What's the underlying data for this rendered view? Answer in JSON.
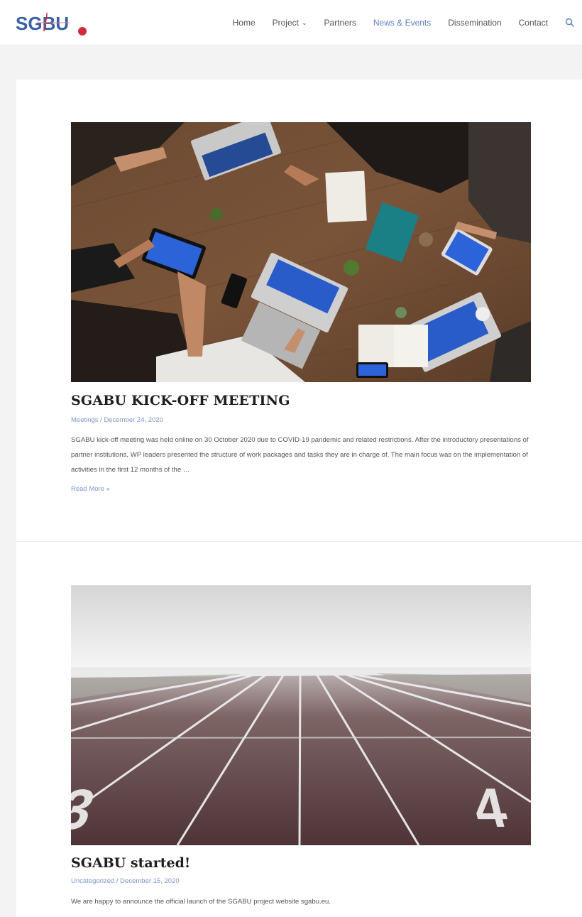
{
  "header": {
    "logo_text": "SGBU",
    "nav": [
      {
        "label": "Home"
      },
      {
        "label": "Project",
        "has_dropdown": true
      },
      {
        "label": "Partners"
      },
      {
        "label": "News & Events",
        "active": true
      },
      {
        "label": "Dissemination"
      },
      {
        "label": "Contact"
      }
    ],
    "search_icon": "search-icon"
  },
  "posts": [
    {
      "title": "SGABU KICK-OFF MEETING",
      "meta": "Meetings / December 24, 2020",
      "excerpt": "SGABU kick-off meeting was held online on 30 October 2020 due to COVID-19 pandemic and related restrictions. After the introductory presentations of partner institutions, WP leaders presented the structure of work packages and tasks they are in charge of. The main focus was on the implementation of activities in the first 12 months of the …",
      "read_more": "Read More »",
      "image": "team meeting around wooden table with laptops and tablets"
    },
    {
      "title": "SGABU started!",
      "meta": "Uncategorized / December 15, 2020",
      "excerpt": "We are happy to announce the official launch of the SGABU project website sgabu.eu.",
      "image": "running track lanes 3 and 4 in fog"
    }
  ],
  "colors": {
    "accent": "#5e7fc4",
    "meta": "#7f96c9",
    "title": "#1e1e1e",
    "logo_blue": "#3a5fa8",
    "logo_red": "#d42b3a"
  }
}
